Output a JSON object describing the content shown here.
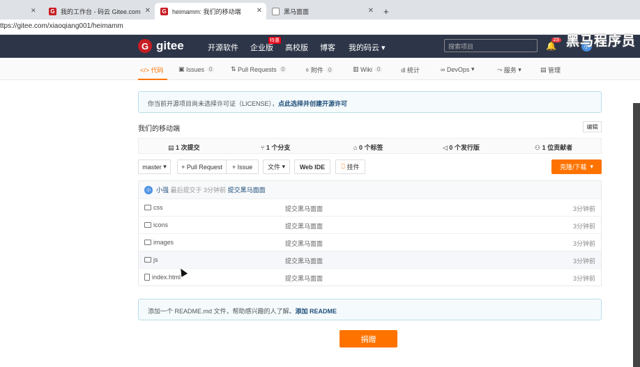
{
  "browser": {
    "tabs": [
      {
        "label": "我的工作台 - 码云 Gitee.com",
        "active": false
      },
      {
        "label": "heimamm: 我们的移动端",
        "active": true
      },
      {
        "label": "黑马面面",
        "active": false
      }
    ],
    "new_tab": "+",
    "url": "ttps://gitee.com/xiaoqiang001/heimamm"
  },
  "header": {
    "logo_text": "gitee",
    "logo_glyph": "G",
    "nav": [
      "开源软件",
      "企业版",
      "高校版",
      "博客",
      "我的码云"
    ],
    "badge": "特惠",
    "search_placeholder": "搜索项目",
    "notification_count": "23",
    "avatar_text": "小",
    "watermark": "黑马程序员"
  },
  "repo_nav": [
    {
      "label": "代码",
      "count": "",
      "icon": "code-icon"
    },
    {
      "label": "Issues",
      "count": "0",
      "icon": "issue-icon"
    },
    {
      "label": "Pull Requests",
      "count": "0",
      "icon": "pr-icon"
    },
    {
      "label": "附件",
      "count": "0",
      "icon": "attach-icon"
    },
    {
      "label": "Wiki",
      "count": "0",
      "icon": "wiki-icon"
    },
    {
      "label": "统计",
      "count": "",
      "icon": "stats-icon"
    },
    {
      "label": "DevOps",
      "count": "",
      "icon": "devops-icon"
    },
    {
      "label": "服务",
      "count": "",
      "icon": "service-icon"
    },
    {
      "label": "管理",
      "count": "",
      "icon": "manage-icon"
    }
  ],
  "license_notice": {
    "text": "你当前开源项目尚未选择许可证（LICENSE），",
    "link": "点此选择并创建开源许可"
  },
  "description": "我们的移动端",
  "edit_label": "编辑",
  "stats": {
    "commits": "1 次提交",
    "branches": "1 个分支",
    "tags": "0 个标签",
    "releases": "0 个发行版",
    "contributors": "1 位贡献者"
  },
  "toolbar": {
    "branch": "master",
    "pull_request": "+ Pull Request",
    "issue": "+ Issue",
    "file": "文件",
    "webide": "Web IDE",
    "plugin": "挂件",
    "clone": "克隆/下载"
  },
  "last_commit": {
    "avatar": "小",
    "author": "小强",
    "meta": "最后提交于 3分钟前",
    "message": "提交黑马面面"
  },
  "files": [
    {
      "name": "css",
      "type": "dir",
      "message": "提交黑马面面",
      "time": "3分钟前"
    },
    {
      "name": "icons",
      "type": "dir",
      "message": "提交黑马面面",
      "time": "3分钟前"
    },
    {
      "name": "images",
      "type": "dir",
      "message": "提交黑马面面",
      "time": "3分钟前"
    },
    {
      "name": "js",
      "type": "dir",
      "message": "提交黑马面面",
      "time": "3分钟前"
    },
    {
      "name": "index.html",
      "type": "file",
      "message": "提交黑马面面",
      "time": "3分钟前"
    }
  ],
  "readme_notice": {
    "text": "添加一个 README.md 文件，帮助感兴趣的人了解。",
    "link": "添加 README"
  },
  "donate": "捐赠"
}
